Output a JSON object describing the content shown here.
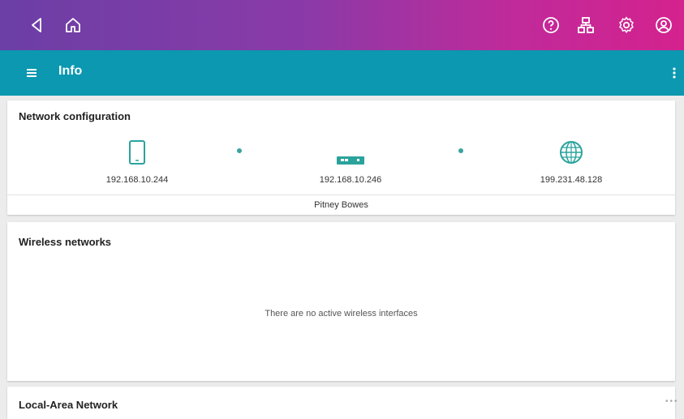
{
  "appbar": {
    "title": "Info"
  },
  "network_config": {
    "title": "Network configuration",
    "device_ip": "192.168.10.244",
    "router_ip": "192.168.10.246",
    "internet_ip": "199.231.48.128",
    "network_name": "Pitney Bowes"
  },
  "wireless": {
    "title": "Wireless networks",
    "empty_message": "There are no active wireless interfaces"
  },
  "lan": {
    "title": "Local-Area Network"
  },
  "colors": {
    "topbar_start": "#6b3fa6",
    "topbar_end": "#d4228e",
    "appbar": "#0b98b0",
    "node_icon": "#2aa39c"
  }
}
